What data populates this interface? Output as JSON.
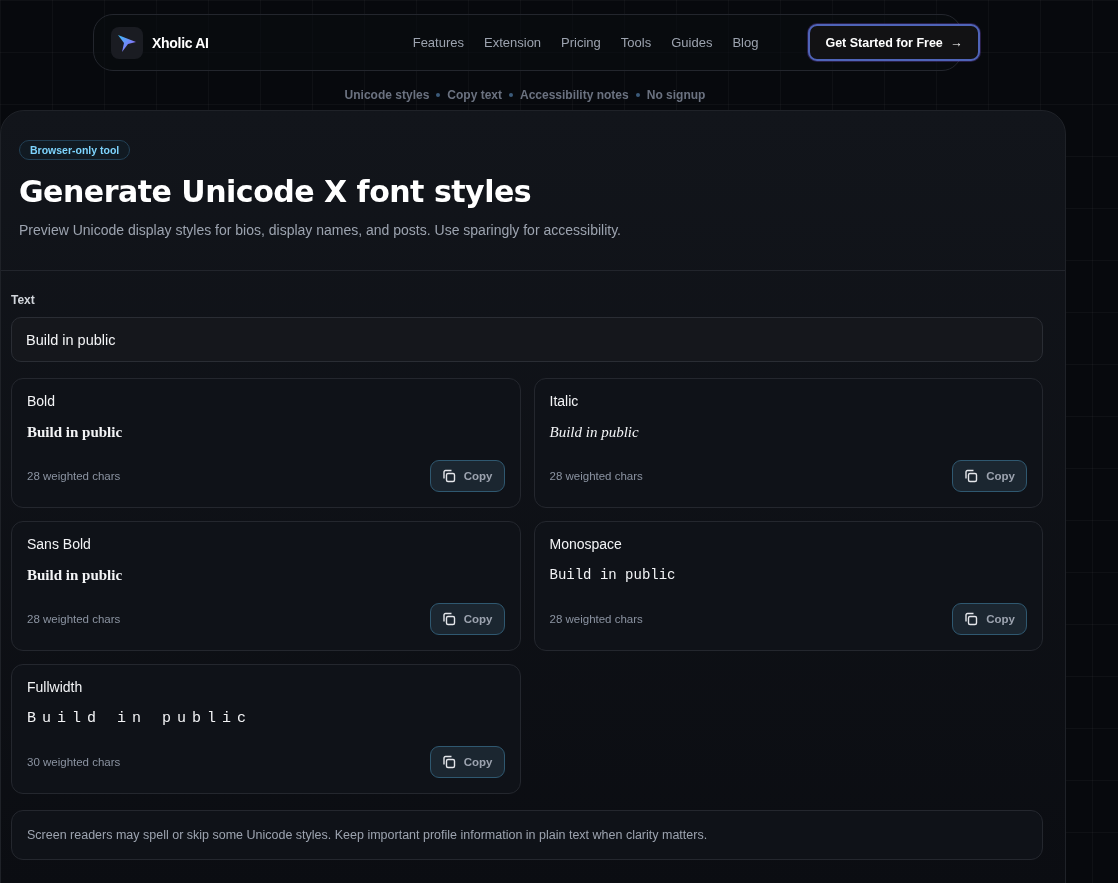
{
  "nav": {
    "brand": "Xholic AI",
    "links": [
      "Features",
      "Extension",
      "Pricing",
      "Tools",
      "Guides",
      "Blog"
    ],
    "cta": "Get Started for Free",
    "cta_icon": "→"
  },
  "highlights": [
    "Unicode styles",
    "Copy text",
    "Accessibility notes",
    "No signup"
  ],
  "tool": {
    "badge": "Browser-only tool",
    "title": "Generate Unicode X font styles",
    "subtitle": "Preview Unicode display styles for bios, display names, and posts. Use sparingly for accessibility.",
    "input": {
      "label": "Text",
      "value": "Build in public"
    },
    "styles": [
      {
        "name": "Bold",
        "kind": "bold",
        "preview": "Build in public",
        "count": "28 weighted chars",
        "button": "Copy"
      },
      {
        "name": "Italic",
        "kind": "italic",
        "preview": "Build in public",
        "count": "28 weighted chars",
        "button": "Copy"
      },
      {
        "name": "Sans Bold",
        "kind": "sans_bold",
        "preview": "Build in public",
        "count": "28 weighted chars",
        "button": "Copy"
      },
      {
        "name": "Monospace",
        "kind": "monospace",
        "preview": "Build in public",
        "count": "28 weighted chars",
        "button": "Copy"
      },
      {
        "name": "Fullwidth",
        "kind": "fullwidth",
        "preview": "Build in public",
        "count": "30 weighted chars",
        "button": "Copy"
      }
    ],
    "note": "Screen readers may spell or skip some Unicode styles. Keep important profile information in plain text when clarity matters."
  }
}
